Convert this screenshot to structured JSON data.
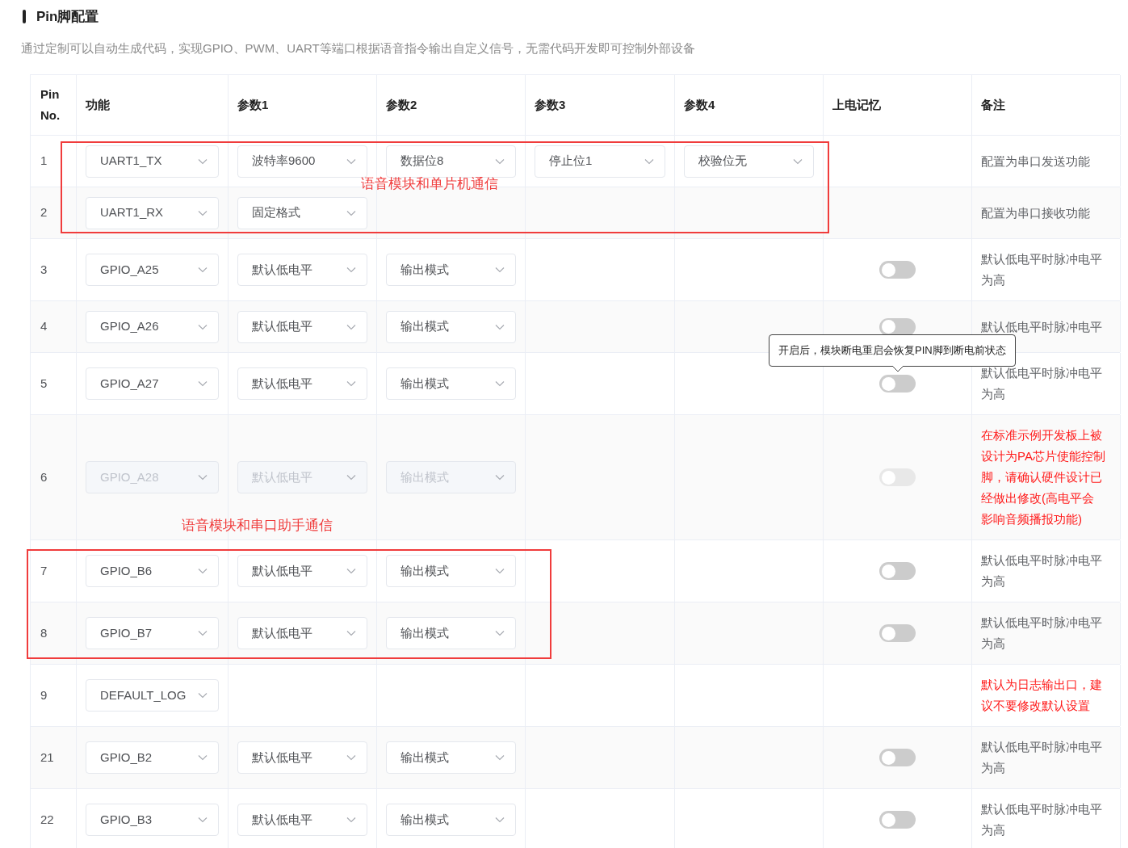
{
  "section": {
    "title": "Pin脚配置",
    "description": "通过定制可以自动生成代码，实现GPIO、PWM、UART等端口根据语音指令输出自定义信号，无需代码开发即可控制外部设备"
  },
  "table": {
    "columns": [
      "Pin No.",
      "功能",
      "参数1",
      "参数2",
      "参数3",
      "参数4",
      "上电记忆",
      "备注"
    ],
    "rows": [
      {
        "pin": "1",
        "disabled": false,
        "selects": [
          "UART1_TX",
          "波特率9600",
          "数据位8",
          "停止位1",
          "校验位无"
        ],
        "remark": "配置为串口发送功能",
        "warning": false
      },
      {
        "pin": "2",
        "disabled": false,
        "selects": [
          "UART1_RX",
          "固定格式"
        ],
        "remark": "配置为串口接收功能",
        "warning": false
      },
      {
        "pin": "3",
        "disabled": false,
        "selects": [
          "GPIO_A25",
          "默认低电平",
          "输出模式"
        ],
        "memory": {
          "on": false
        },
        "remark": "默认低电平时脉冲电平为高",
        "warning": false
      },
      {
        "pin": "4",
        "disabled": false,
        "selects": [
          "GPIO_A26",
          "默认低电平",
          "输出模式"
        ],
        "memory": {
          "on": false
        },
        "remark": "默认低电平时脉冲电平",
        "warning": false
      },
      {
        "pin": "5",
        "disabled": false,
        "selects": [
          "GPIO_A27",
          "默认低电平",
          "输出模式"
        ],
        "memory": {
          "on": false
        },
        "remark": "默认低电平时脉冲电平为高",
        "warning": false
      },
      {
        "pin": "6",
        "disabled": true,
        "selects": [
          "GPIO_A28",
          "默认低电平",
          "输出模式"
        ],
        "memory": {
          "on": false
        },
        "remark": "在标准示例开发板上被设计为PA芯片使能控制脚，请确认硬件设计已经做出修改(高电平会影响音频播报功能)",
        "warning": true
      },
      {
        "pin": "7",
        "disabled": false,
        "selects": [
          "GPIO_B6",
          "默认低电平",
          "输出模式"
        ],
        "memory": {
          "on": false
        },
        "remark": "默认低电平时脉冲电平为高",
        "warning": false
      },
      {
        "pin": "8",
        "disabled": false,
        "selects": [
          "GPIO_B7",
          "默认低电平",
          "输出模式"
        ],
        "memory": {
          "on": false
        },
        "remark": "默认低电平时脉冲电平为高",
        "warning": false
      },
      {
        "pin": "9",
        "disabled": false,
        "selects": [
          "DEFAULT_LOG"
        ],
        "remark": "默认为日志输出口，建议不要修改默认设置",
        "warning": true
      },
      {
        "pin": "21",
        "disabled": false,
        "selects": [
          "GPIO_B2",
          "默认低电平",
          "输出模式"
        ],
        "memory": {
          "on": false
        },
        "remark": "默认低电平时脉冲电平为高",
        "warning": false
      },
      {
        "pin": "22",
        "disabled": false,
        "selects": [
          "GPIO_B3",
          "默认低电平",
          "输出模式"
        ],
        "memory": {
          "on": false
        },
        "remark": "默认低电平时脉冲电平为高",
        "warning": false
      }
    ]
  },
  "tooltip": "开启后，模块断电重启会恢复PIN脚到断电前状态",
  "annotations": [
    {
      "label": "语音模块和单片机通信"
    },
    {
      "label": "语音模块和串口助手通信"
    }
  ]
}
